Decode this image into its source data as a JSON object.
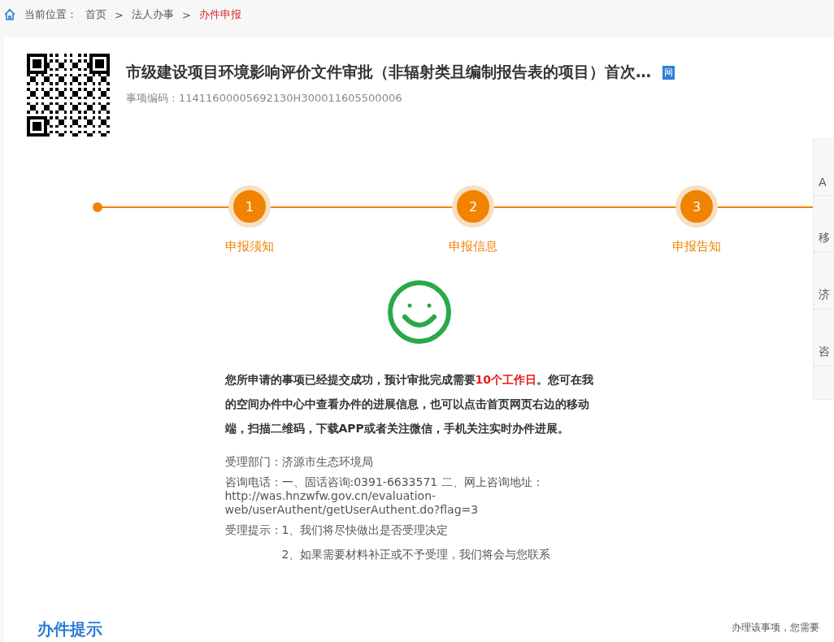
{
  "breadcrumb": {
    "prefix": "当前位置：",
    "separators": [
      ">",
      ">"
    ],
    "items": [
      {
        "label": "首页",
        "current": false
      },
      {
        "label": "法人办事",
        "current": false
      },
      {
        "label": "办件申报",
        "current": true
      }
    ]
  },
  "item": {
    "title": "市级建设项目环境影响评价文件审批（非辐射类且编制报告表的项目）首次…",
    "badge": "网",
    "code": "事项编码：11411600005692130H300011605500006"
  },
  "steps": [
    {
      "number": "1",
      "label": "申报须知"
    },
    {
      "number": "2",
      "label": "申报信息"
    },
    {
      "number": "3",
      "label": "申报告知"
    }
  ],
  "result": {
    "message": "您所申请的事项已经提交成功，预计审批完成需要**10个工作日**。您可在我的空间办件中心中查看办件的进展信息，也可以点击首页网页右边的移动端，扫描二维码，下载APP或者关注微信，手机关注实时办件进展。",
    "department": "受理部门：济源市生态环境局",
    "phone": "咨询电话：一、固话咨询:0391-6633571 二、网上咨询地址：http://was.hnzwfw.gov.cn/evaluation-web/userAuthent/getUserAuthent.do?flag=3",
    "tips_label": "受理提示：",
    "tips": [
      "1、我们将尽快做出是否受理决定",
      "2、如果需要材料补正或不予受理，我们将会与您联系"
    ]
  },
  "side_panel": {
    "items": [
      "A",
      "移",
      "济",
      "咨"
    ]
  },
  "section_title": "办件提示",
  "section_note": "办理该事项，您需要"
}
